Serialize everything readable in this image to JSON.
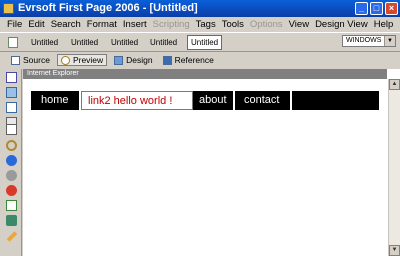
{
  "window": {
    "title": "Evrsoft First Page 2006 - [Untitled]"
  },
  "menu": [
    {
      "label": "File",
      "enabled": true
    },
    {
      "label": "Edit",
      "enabled": true
    },
    {
      "label": "Search",
      "enabled": true
    },
    {
      "label": "Format",
      "enabled": true
    },
    {
      "label": "Insert",
      "enabled": true
    },
    {
      "label": "Scripting",
      "enabled": false
    },
    {
      "label": "Tags",
      "enabled": true
    },
    {
      "label": "Tools",
      "enabled": true
    },
    {
      "label": "Options",
      "enabled": false
    },
    {
      "label": "View",
      "enabled": true
    },
    {
      "label": "Design View",
      "enabled": true
    },
    {
      "label": "Help",
      "enabled": true
    }
  ],
  "doc_tabs": [
    "Untitled",
    "Untitled",
    "Untitled",
    "Untitled",
    "Untitled"
  ],
  "doc_tab_active_index": 4,
  "encoding_select": {
    "value": "WINDOWS"
  },
  "view_tabs": [
    {
      "label": "Source",
      "icon": "document-icon"
    },
    {
      "label": "Preview",
      "icon": "magnifier-icon",
      "active": true
    },
    {
      "label": "Design",
      "icon": "monitor-icon"
    },
    {
      "label": "Reference",
      "icon": "book-icon"
    }
  ],
  "preview": {
    "browser_label": "Internet Explorer"
  },
  "site_nav": {
    "items": [
      {
        "label": "home",
        "selected": false
      },
      {
        "label": "link2 hello world !",
        "selected": true
      },
      {
        "label": "about",
        "selected": false
      },
      {
        "label": "contact",
        "selected": false
      }
    ],
    "colors": {
      "bar": "#000000",
      "text": "#ffffff",
      "selected_text": "#c00000"
    }
  },
  "left_tools": [
    "crosshair-icon",
    "image-icon",
    "table-icon",
    "form-icon",
    "text-icon",
    "zoom-icon",
    "back-icon",
    "forward-icon",
    "stop-icon",
    "refresh-icon",
    "pen-icon",
    "pencil-icon"
  ]
}
